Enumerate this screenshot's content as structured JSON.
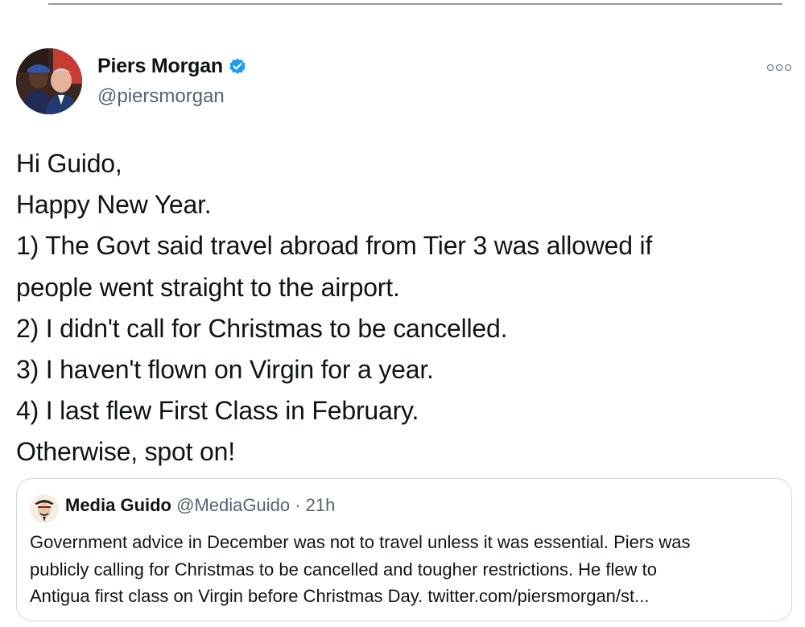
{
  "author": {
    "display_name": "Piers Morgan",
    "handle": "@piersmorgan",
    "verified": true,
    "avatar_icon": "profile-photo"
  },
  "tweet": {
    "lines": [
      "Hi Guido,",
      "Happy New Year.",
      "1) The Govt said travel abroad from Tier 3 was allowed if",
      "people went straight to the airport.",
      "2) I didn't call for Christmas to be cancelled.",
      "3) I haven't flown on Virgin for a year.",
      "4) I last flew First Class in February.",
      "Otherwise, spot on!"
    ]
  },
  "quoted_tweet": {
    "display_name": "Media Guido",
    "handle": "@MediaGuido",
    "separator": "·",
    "time": "21h",
    "lines": [
      "Government advice in December was not to travel unless it was essential. Piers was",
      "publicly calling for Christmas to be cancelled and tougher restrictions. He flew to",
      "Antigua first class on Virgin before Christmas Day. twitter.com/piersmorgan/st..."
    ]
  },
  "colors": {
    "text": "#0f1419",
    "secondary": "#536471",
    "verified_blue": "#1d9bf0",
    "border": "#cfd9de"
  }
}
